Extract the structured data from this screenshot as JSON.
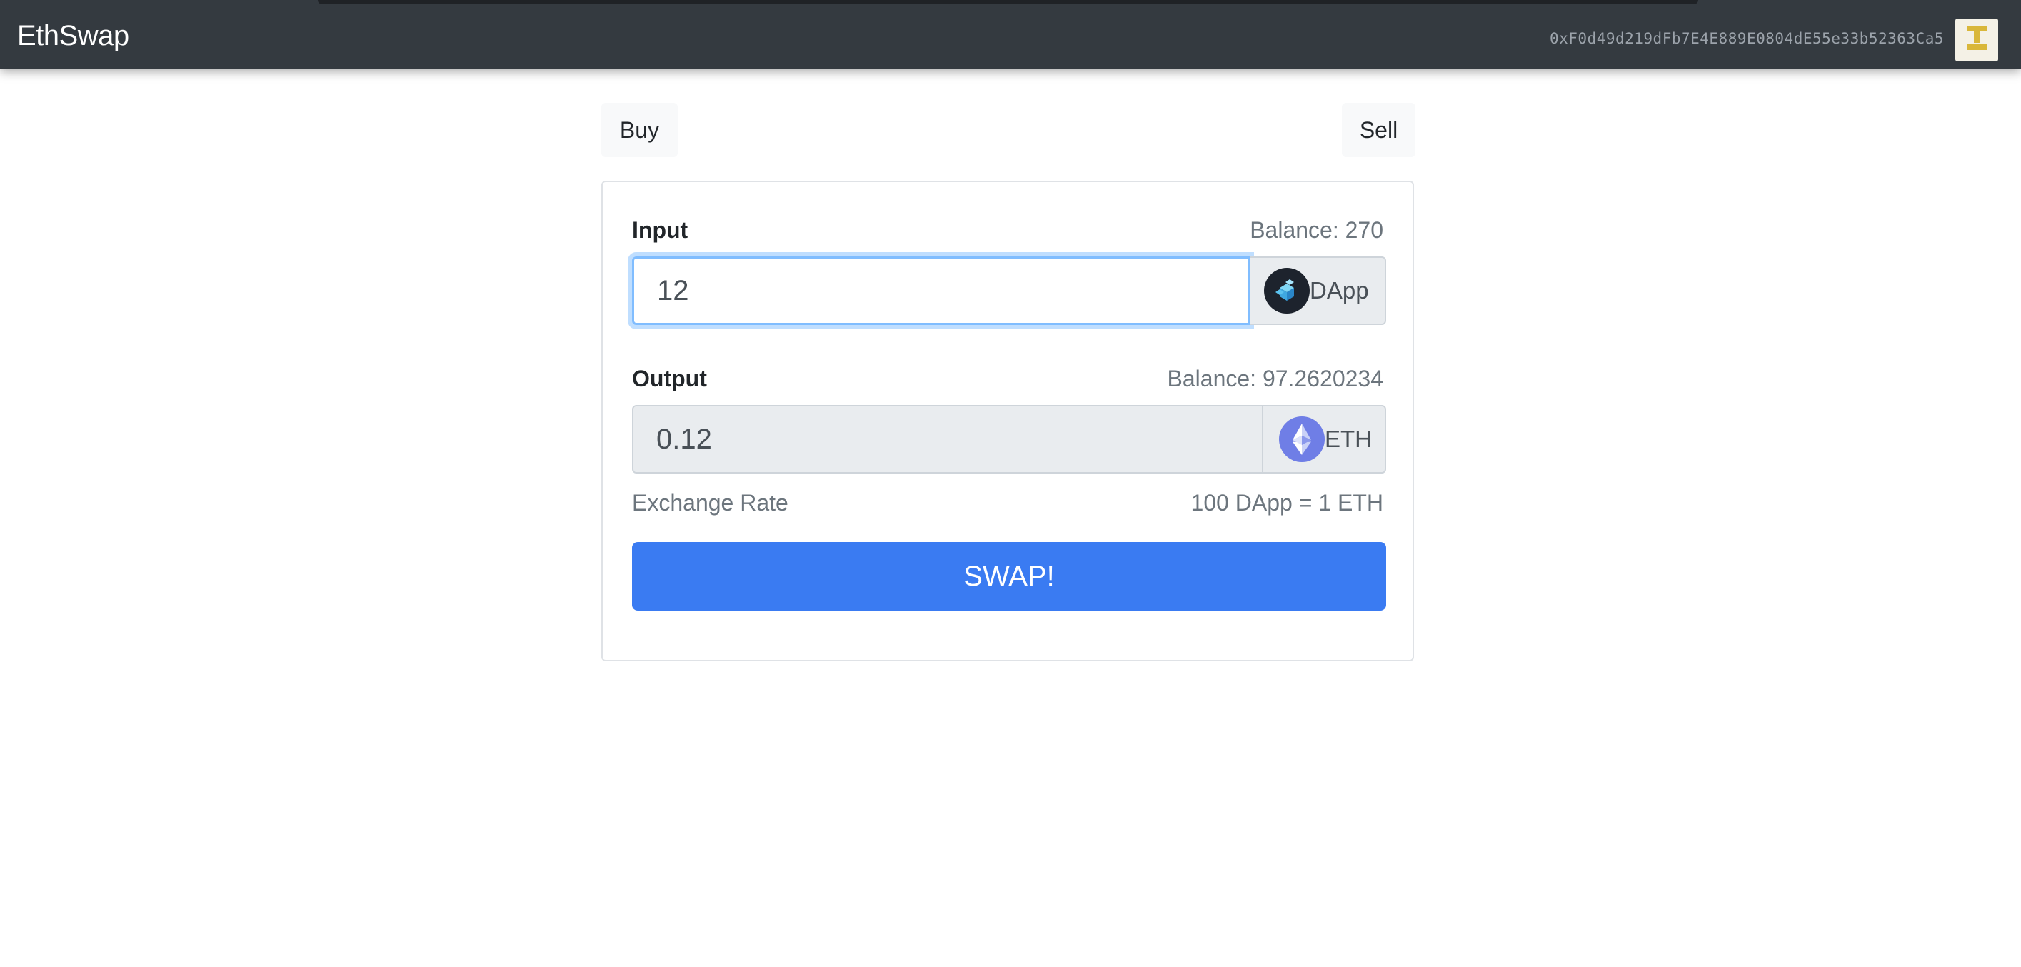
{
  "navbar": {
    "brand": "EthSwap",
    "account": "0xF0d49d219dFb7E4E889E0804dE55e33b52363Ca5",
    "avatar_icon": "identicon-avatar"
  },
  "tabs": {
    "buy_label": "Buy",
    "sell_label": "Sell"
  },
  "form": {
    "input": {
      "label": "Input",
      "balance": "Balance: 270",
      "value": "12",
      "token_label": "DApp",
      "token_icon": "dapp-token-icon"
    },
    "output": {
      "label": "Output",
      "balance": "Balance: 97.2620234",
      "value": "0.12",
      "token_label": "ETH",
      "token_icon": "eth-token-icon"
    },
    "exchange_rate_label": "Exchange Rate",
    "exchange_rate_value": "100 DApp = 1 ETH",
    "swap_label": "SWAP!"
  },
  "colors": {
    "navbar": "#343a40",
    "swap_button": "#3a7bf2",
    "focus_ring": "#80bdff",
    "eth_icon": "#6f7ee6",
    "dapp_icon_bg": "#1d232d"
  }
}
